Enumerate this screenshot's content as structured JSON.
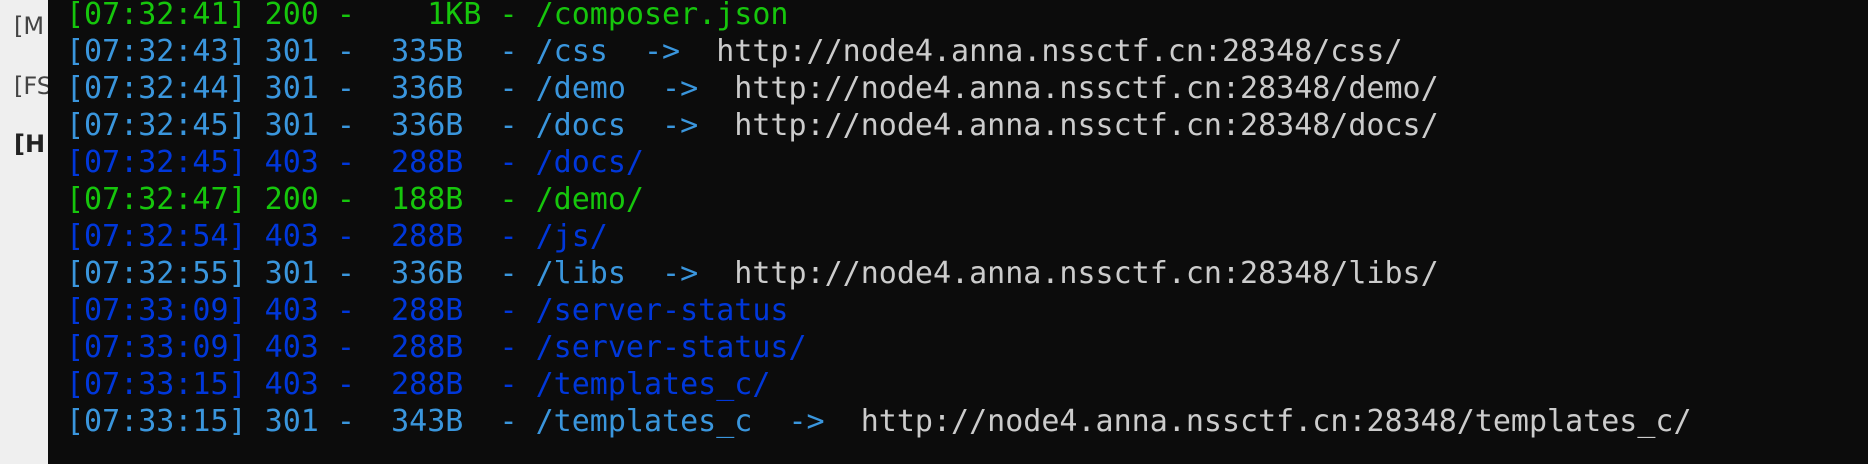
{
  "background_window": {
    "fragments": [
      "[M",
      "[FS",
      "[H"
    ]
  },
  "terminal": {
    "colors": {
      "status_200": "#16c60c",
      "status_301": "#3a96dd",
      "status_403": "#0037da",
      "redirect_target": "#cccccc",
      "background": "#0c0c0c"
    },
    "lines": [
      {
        "text": "[07:32:41] 200 -    1KB - /composer.json",
        "target": ""
      },
      {
        "text": "[07:32:43] 301 -  335B  - /css  ->  ",
        "target": "http://node4.anna.nssctf.cn:28348/css/"
      },
      {
        "text": "[07:32:44] 301 -  336B  - /demo  ->  ",
        "target": "http://node4.anna.nssctf.cn:28348/demo/"
      },
      {
        "text": "[07:32:45] 301 -  336B  - /docs  ->  ",
        "target": "http://node4.anna.nssctf.cn:28348/docs/"
      },
      {
        "text": "[07:32:45] 403 -  288B  - /docs/",
        "target": ""
      },
      {
        "text": "[07:32:47] 200 -  188B  - /demo/",
        "target": ""
      },
      {
        "text": "[07:32:54] 403 -  288B  - /js/",
        "target": ""
      },
      {
        "text": "[07:32:55] 301 -  336B  - /libs  ->  ",
        "target": "http://node4.anna.nssctf.cn:28348/libs/"
      },
      {
        "text": "[07:33:09] 403 -  288B  - /server-status",
        "target": ""
      },
      {
        "text": "[07:33:09] 403 -  288B  - /server-status/",
        "target": ""
      },
      {
        "text": "[07:33:15] 403 -  288B  - /templates_c/",
        "target": ""
      },
      {
        "text": "[07:33:15] 301 -  343B  - /templates_c  ->  ",
        "target": "http://node4.anna.nssctf.cn:28348/templates_c/"
      }
    ]
  }
}
